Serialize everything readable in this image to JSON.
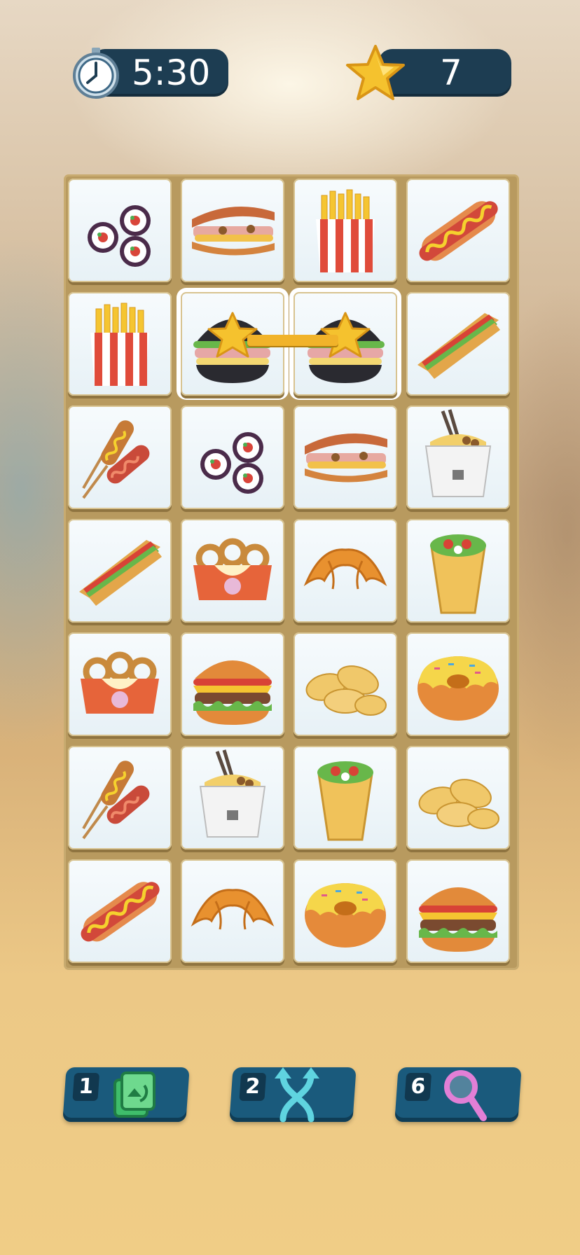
{
  "hud": {
    "timer": "5:30",
    "stars": "7"
  },
  "board": {
    "columns": 4,
    "rows": 7,
    "tiles": [
      "sushi-roll",
      "toast-sandwich",
      "french-fries",
      "hot-dog",
      "french-fries",
      "black-burger",
      "black-burger",
      "club-sandwich",
      "corn-dog",
      "sushi-roll",
      "toast-sandwich",
      "noodle-box",
      "club-sandwich",
      "onion-rings",
      "croissant",
      "burrito-wrap",
      "onion-rings",
      "cheeseburger",
      "potato-chips",
      "donut",
      "corn-dog",
      "noodle-box",
      "burrito-wrap",
      "potato-chips",
      "hot-dog",
      "croissant",
      "donut",
      "cheeseburger"
    ],
    "selected": [
      5,
      6
    ]
  },
  "boosters": [
    {
      "count": "1",
      "icon": "shuffle-icon"
    },
    {
      "count": "2",
      "icon": "swap-arrows-icon"
    },
    {
      "count": "6",
      "icon": "magnifier-icon"
    }
  ],
  "colors": {
    "hud_pill": "#1d3d52",
    "booster": "#1a5a7c",
    "star": "#f5c22e",
    "board_frame": "#b89a5f"
  }
}
